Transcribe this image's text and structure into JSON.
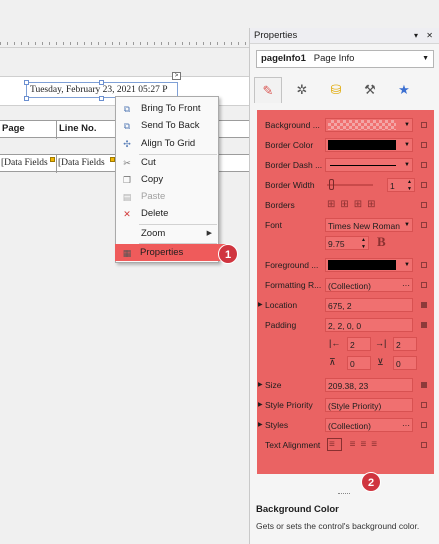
{
  "designer": {
    "date_text": "Tuesday, February 23, 2021 05:27 P",
    "smart_tag_symbol": ">",
    "header_cells": [
      "Page",
      "Line No."
    ],
    "detail_cells": [
      "[Data Fields",
      "[Data Fields"
    ]
  },
  "context_menu": {
    "items": [
      {
        "label": "Bring To Front",
        "icon": "bring-to-front-icon",
        "glyph": "⧉",
        "disabled": false
      },
      {
        "label": "Send To Back",
        "icon": "send-to-back-icon",
        "glyph": "⧉",
        "disabled": false
      },
      {
        "label": "Align To Grid",
        "icon": "align-to-grid-icon",
        "glyph": "✣",
        "disabled": false
      },
      {
        "label": "Cut",
        "icon": "cut-icon",
        "glyph": "✂",
        "disabled": false
      },
      {
        "label": "Copy",
        "icon": "copy-icon",
        "glyph": "❐",
        "disabled": false
      },
      {
        "label": "Paste",
        "icon": "paste-icon",
        "glyph": "▤",
        "disabled": true
      },
      {
        "label": "Delete",
        "icon": "delete-icon",
        "glyph": "✕",
        "disabled": false
      },
      {
        "label": "Zoom",
        "icon": "",
        "glyph": "",
        "disabled": false,
        "submenu_arrow": "▶"
      },
      {
        "label": "Properties",
        "icon": "properties-icon",
        "glyph": "▦",
        "disabled": false
      }
    ],
    "highlight_color": "#ef5b5b"
  },
  "badges": {
    "one": "1",
    "two": "2",
    "color": "#d0353f"
  },
  "properties": {
    "title": "Properties",
    "title_buttons": "▾ ✕",
    "object_name": "pageInfo1",
    "object_type": "Page Info",
    "tabs": [
      {
        "icon": "brush-icon",
        "glyph": "✎"
      },
      {
        "icon": "gear-icon",
        "glyph": "✲"
      },
      {
        "icon": "database-icon",
        "glyph": "⛁"
      },
      {
        "icon": "wrench-icon",
        "glyph": "⚒"
      },
      {
        "icon": "star-icon",
        "glyph": "★"
      }
    ],
    "grid_color": "#ea6363",
    "rows": {
      "background": {
        "label": "Background ..."
      },
      "border_color": {
        "label": "Border Color"
      },
      "border_dash": {
        "label": "Border Dash ..."
      },
      "border_width": {
        "label": "Border Width",
        "value": "1"
      },
      "borders": {
        "label": "Borders"
      },
      "font": {
        "label": "Font",
        "value": "Times New Roman",
        "size": "9.75",
        "bold_glyph": "B"
      },
      "foreground": {
        "label": "Foreground ..."
      },
      "formatting": {
        "label": "Formatting R...",
        "value": "(Collection)"
      },
      "location": {
        "label": "Location",
        "value": "675, 2"
      },
      "padding": {
        "label": "Padding",
        "value": "2, 2, 0, 0",
        "left": "2",
        "right": "2",
        "top": "0",
        "bottom": "0"
      },
      "size": {
        "label": "Size",
        "value": "209.38, 23"
      },
      "style_priority": {
        "label": "Style Priority",
        "value": "(Style Priority)"
      },
      "styles": {
        "label": "Styles",
        "value": "(Collection)"
      },
      "text_alignment": {
        "label": "Text Alignment"
      }
    },
    "description": {
      "title": "Background Color",
      "text": "Gets or sets the control's background color."
    }
  }
}
